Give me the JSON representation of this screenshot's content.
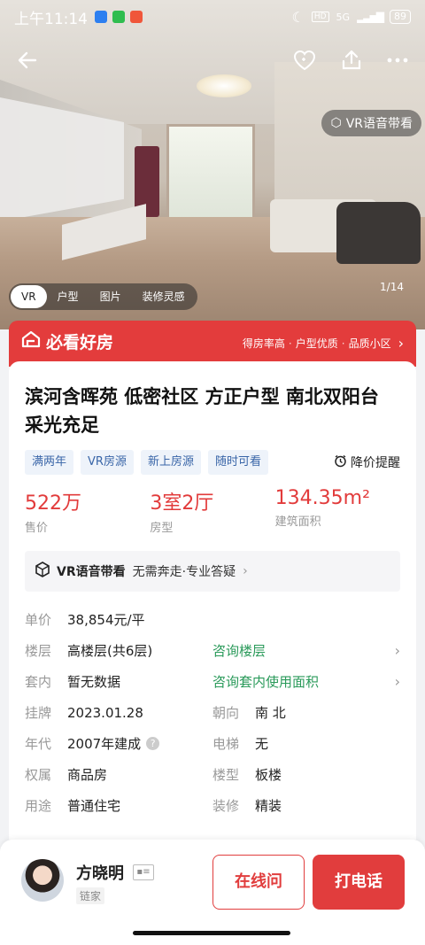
{
  "status": {
    "time": "上午11:14",
    "network": "5G",
    "battery": "89"
  },
  "hero": {
    "vr_label": "VR语音带看",
    "media_tabs": [
      "VR",
      "户型",
      "图片",
      "装修灵感"
    ],
    "counter": "1/14"
  },
  "banner": {
    "title": "必看好房",
    "features": [
      "得房率高",
      "户型优质",
      "品质小区"
    ]
  },
  "listing": {
    "title": "滨河含晖苑 低密社区 方正户型 南北双阳台 采光充足",
    "tags": [
      "满两年",
      "VR房源",
      "新上房源",
      "随时可看"
    ],
    "price_alert": "降价提醒",
    "stats": [
      {
        "value": "522万",
        "label": "售价"
      },
      {
        "value": "3室2厅",
        "label": "房型"
      },
      {
        "value": "134.35m²",
        "label": "建筑面积"
      }
    ],
    "vr_bar": {
      "main": "VR语音带看",
      "sub": "无需奔走·专业答疑"
    }
  },
  "details": {
    "unit_price": {
      "label": "单价",
      "value": "38,854元/平"
    },
    "floor": {
      "label": "楼层",
      "value": "高楼层(共6层)",
      "link": "咨询楼层"
    },
    "inner": {
      "label": "套内",
      "value": "暂无数据",
      "link": "咨询套内使用面积"
    },
    "listed": {
      "label": "挂牌",
      "value": "2023.01.28"
    },
    "orientation": {
      "label": "朝向",
      "value": "南 北"
    },
    "year": {
      "label": "年代",
      "value": "2007年建成"
    },
    "elevator": {
      "label": "电梯",
      "value": "无"
    },
    "ownership": {
      "label": "权属",
      "value": "商品房"
    },
    "building_type": {
      "label": "楼型",
      "value": "板楼"
    },
    "usage": {
      "label": "用途",
      "value": "普通住宅"
    },
    "decoration": {
      "label": "装修",
      "value": "精装"
    }
  },
  "agent": {
    "name": "方晓明",
    "company": "链家",
    "ask_label": "在线问",
    "call_label": "打电话"
  }
}
